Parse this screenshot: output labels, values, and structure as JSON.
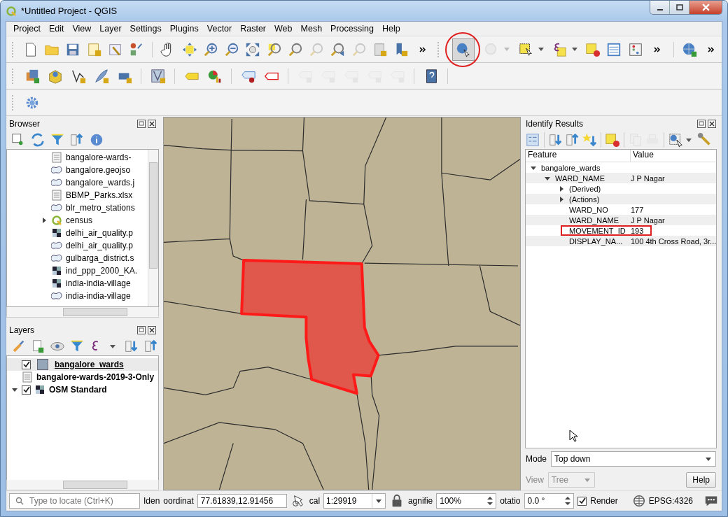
{
  "window": {
    "title": "*Untitled Project - QGIS"
  },
  "menu": [
    {
      "label": "Project"
    },
    {
      "label": "Edit"
    },
    {
      "label": "View"
    },
    {
      "label": "Layer"
    },
    {
      "label": "Settings"
    },
    {
      "label": "Plugins"
    },
    {
      "label": "Vector"
    },
    {
      "label": "Raster"
    },
    {
      "label": "Web"
    },
    {
      "label": "Mesh"
    },
    {
      "label": "Processing"
    },
    {
      "label": "Help"
    }
  ],
  "map_tools": {
    "identify_active": true,
    "identify_highlighted": true
  },
  "browser": {
    "title": "Browser",
    "items": [
      {
        "label": "bangalore-wards-",
        "kind": "table"
      },
      {
        "label": "bangalore.geojso",
        "kind": "polygon"
      },
      {
        "label": "bangalore_wards.j",
        "kind": "polygon"
      },
      {
        "label": "BBMP_Parks.xlsx",
        "kind": "table"
      },
      {
        "label": "blr_metro_stations",
        "kind": "polygon"
      },
      {
        "label": "census",
        "kind": "project",
        "expanded": false
      },
      {
        "label": "delhi_air_quality.p",
        "kind": "raster"
      },
      {
        "label": "delhi_air_quality.p",
        "kind": "polygon"
      },
      {
        "label": "gulbarga_district.s",
        "kind": "polygon"
      },
      {
        "label": "ind_ppp_2000_KA.",
        "kind": "raster"
      },
      {
        "label": "india-india-village",
        "kind": "raster"
      },
      {
        "label": "india-india-village",
        "kind": "polygon"
      }
    ]
  },
  "layers": {
    "title": "Layers",
    "items": [
      {
        "label": "bangalore_wards",
        "kind": "polygon",
        "checked": true,
        "selected": true
      },
      {
        "label": "bangalore-wards-2019-3-Only",
        "kind": "table",
        "selected": false
      },
      {
        "label": "OSM Standard",
        "kind": "raster",
        "checked": true,
        "expanded": true,
        "selected": false
      }
    ]
  },
  "identify": {
    "title": "Identify Results",
    "columns": [
      "Feature",
      "Value"
    ],
    "tree": [
      {
        "feature": "bangalore_wards",
        "expanded": true,
        "children": [
          {
            "feature": "WARD_NAME",
            "value": "J P Nagar",
            "expanded": true,
            "children": [
              {
                "feature": "(Derived)",
                "expanded": false,
                "highlighted": false
              },
              {
                "feature": "(Actions)",
                "expanded": false,
                "highlighted": false
              },
              {
                "feature": "WARD_NO",
                "value": "177",
                "highlighted": false
              },
              {
                "feature": "WARD_NAME",
                "value": "J P Nagar",
                "highlighted": false
              },
              {
                "feature": "MOVEMENT_ID",
                "value": "193",
                "highlighted": true
              },
              {
                "feature": "DISPLAY_NA...",
                "value": "100 4th Cross Road, 3r...",
                "highlighted": false
              }
            ]
          }
        ]
      }
    ],
    "mode_label": "Mode",
    "mode": "Top down",
    "view_label": "View",
    "view": "Tree",
    "view_disabled": true,
    "help": "Help"
  },
  "status_bar": {
    "locate_placeholder": "Type to locate (Ctrl+K)",
    "identify_label": "Iden",
    "coordinate_label": "oordinat",
    "coordinate": "77.61839,12.91456",
    "scale_label": "cal",
    "scale": "1:29919",
    "magnifier_label": "agnifie",
    "magnifier": "100%",
    "rotation_label": "otatio",
    "rotation": "0.0 °",
    "render_label": "Render",
    "render": true,
    "crs": "EPSG:4326"
  }
}
